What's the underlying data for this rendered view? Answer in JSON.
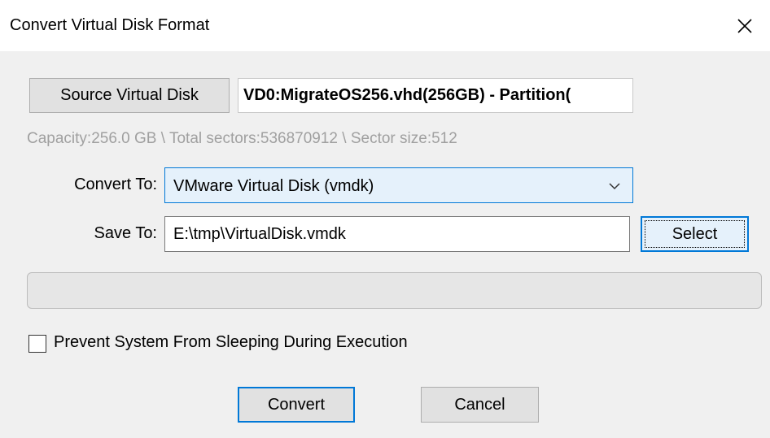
{
  "window": {
    "title": "Convert Virtual Disk Format"
  },
  "icons": {
    "close": "close-icon",
    "dropdown": "chevron-down-icon"
  },
  "source": {
    "button_label": "Source Virtual Disk",
    "value": "VD0:MigrateOS256.vhd(256GB) - Partition("
  },
  "info": "Capacity:256.0 GB \\ Total sectors:536870912 \\ Sector size:512",
  "convert_to": {
    "label": "Convert To:",
    "selected": "VMware Virtual Disk (vmdk)"
  },
  "save_to": {
    "label": "Save To:",
    "value": "E:\\tmp\\VirtualDisk.vmdk",
    "select_label": "Select"
  },
  "progress": {
    "value": 0
  },
  "option": {
    "label": "Prevent System From Sleeping During Execution",
    "checked": false
  },
  "buttons": {
    "convert": "Convert",
    "cancel": "Cancel"
  },
  "colors": {
    "accent": "#0078d7",
    "background": "#f0f0f0"
  }
}
